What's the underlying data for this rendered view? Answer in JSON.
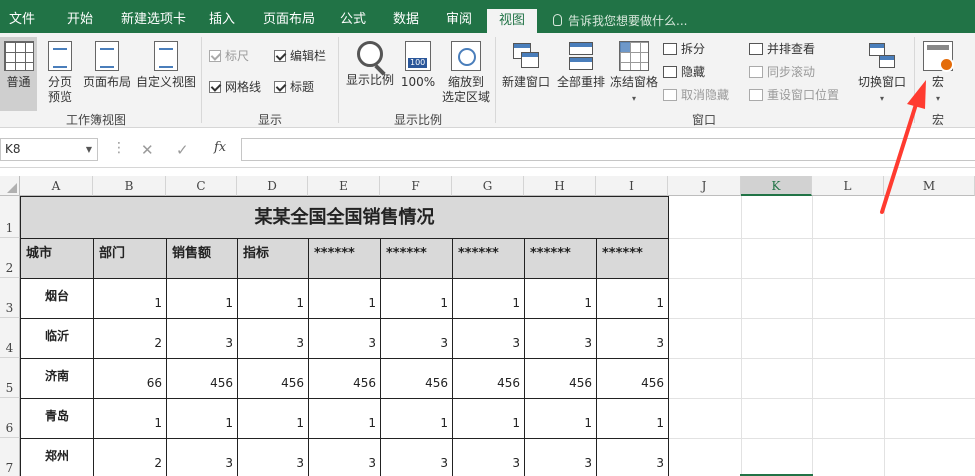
{
  "tabs": [
    "文件",
    "开始",
    "新建选项卡",
    "插入",
    "页面布局",
    "公式",
    "数据",
    "审阅",
    "视图"
  ],
  "active_tab": "视图",
  "tellme": "告诉我您想要做什么...",
  "ribbon": {
    "workbook_views": {
      "label": "工作簿视图",
      "normal": "普通",
      "page_break_line1": "分页",
      "page_break_line2": "预览",
      "page_layout": "页面布局",
      "custom_views": "自定义视图"
    },
    "show": {
      "label": "显示",
      "ruler": "标尺",
      "formula_bar": "编辑栏",
      "gridlines": "网格线",
      "headings": "标题"
    },
    "zoom": {
      "label": "显示比例",
      "zoom": "显示比例",
      "hundred": "100%",
      "hundred_icon": "100",
      "to_selection_line1": "缩放到",
      "to_selection_line2": "选定区域"
    },
    "window": {
      "label": "窗口",
      "new_window": "新建窗口",
      "arrange_all": "全部重排",
      "freeze_panes": "冻结窗格",
      "split": "拆分",
      "hide": "隐藏",
      "unhide": "取消隐藏",
      "side_by_side": "并排查看",
      "sync_scroll": "同步滚动",
      "reset_position": "重设窗口位置",
      "switch_windows": "切换窗口"
    },
    "macros": {
      "label": "宏",
      "macros": "宏"
    }
  },
  "formula_bar": {
    "name_box": "K8",
    "formula": ""
  },
  "columns": [
    "A",
    "B",
    "C",
    "D",
    "E",
    "F",
    "G",
    "H",
    "I",
    "J",
    "K",
    "L",
    "M"
  ],
  "selected_column": "K",
  "rows": [
    "1",
    "2",
    "3",
    "4",
    "5",
    "6",
    "7"
  ],
  "sheet": {
    "title": "某某全国全国销售情况",
    "headers": [
      "城市",
      "部门",
      "销售额",
      "指标",
      "******",
      "******",
      "******",
      "******",
      "******"
    ],
    "data": [
      {
        "city": "烟台",
        "values": [
          "1",
          "1",
          "1",
          "1",
          "1",
          "1",
          "1",
          "1"
        ]
      },
      {
        "city": "临沂",
        "values": [
          "2",
          "3",
          "3",
          "3",
          "3",
          "3",
          "3",
          "3"
        ]
      },
      {
        "city": "济南",
        "values": [
          "66",
          "456",
          "456",
          "456",
          "456",
          "456",
          "456",
          "456"
        ]
      },
      {
        "city": "青岛",
        "values": [
          "1",
          "1",
          "1",
          "1",
          "1",
          "1",
          "1",
          "1"
        ]
      },
      {
        "city": "郑州",
        "values": [
          "2",
          "3",
          "3",
          "3",
          "3",
          "3",
          "3",
          "3"
        ]
      }
    ]
  },
  "colors": {
    "excel_green": "#217346",
    "ribbon_bg": "#f3f3f3",
    "header_fill": "#d9d9d9",
    "arrow": "#ff3b30"
  }
}
